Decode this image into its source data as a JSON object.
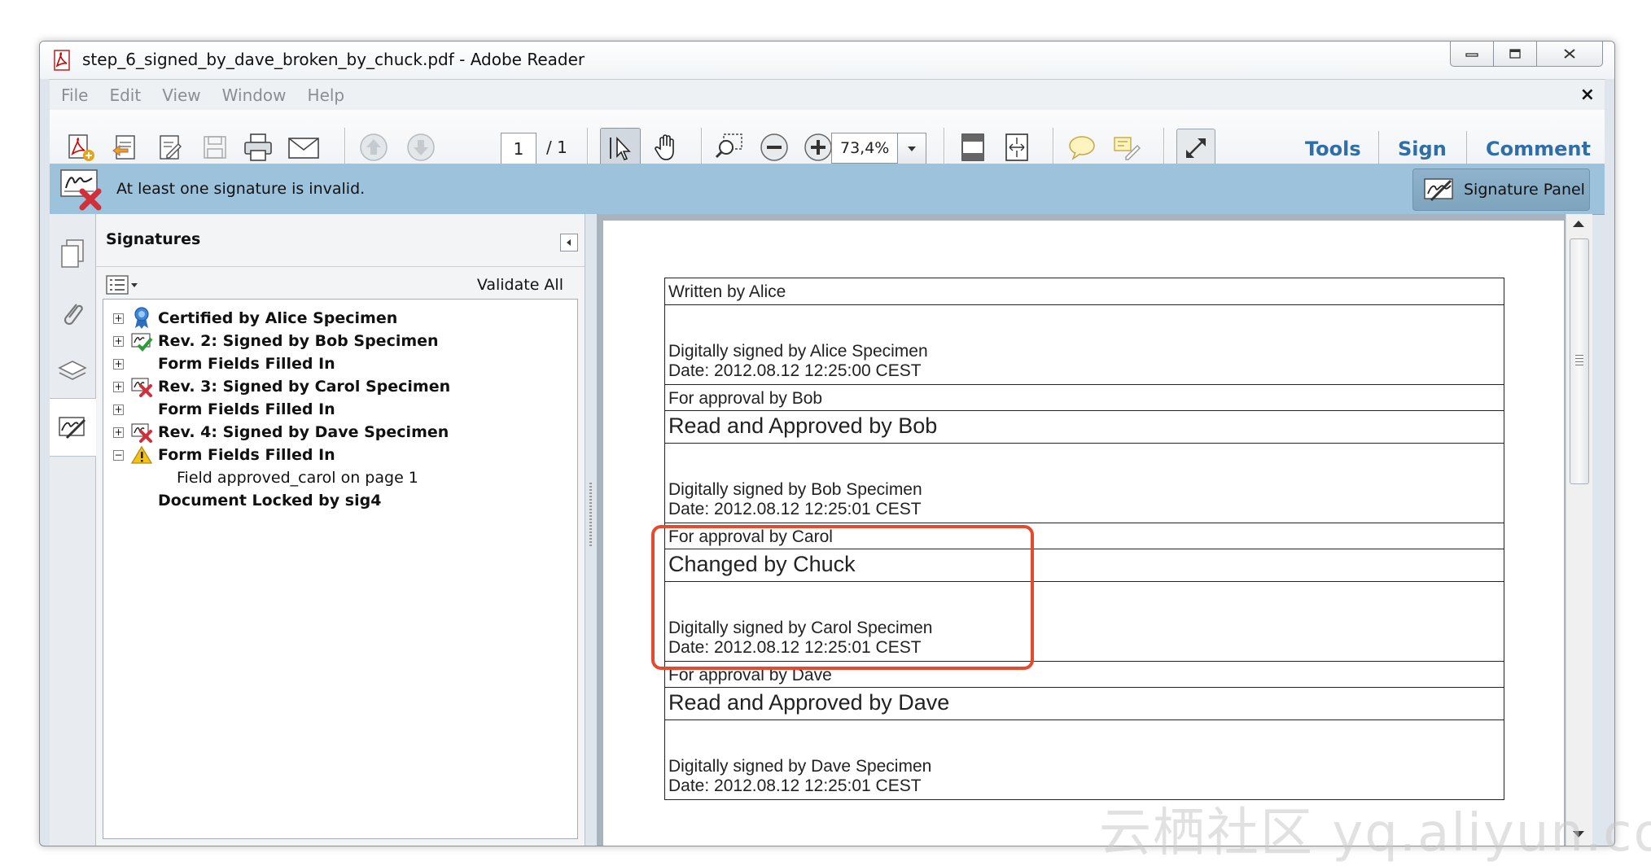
{
  "window": {
    "title": "step_6_signed_by_dave_broken_by_chuck.pdf - Adobe Reader"
  },
  "menu": {
    "items": [
      "File",
      "Edit",
      "View",
      "Window",
      "Help"
    ],
    "close_glyph": "×"
  },
  "toolbar": {
    "page_current": "1",
    "page_total": "/ 1",
    "zoom": "73,4%",
    "links": {
      "tools": "Tools",
      "sign": "Sign",
      "comment": "Comment"
    }
  },
  "infobar": {
    "message": "At least one signature is invalid.",
    "panel_button": "Signature Panel",
    "colors": {
      "background": "#9dc3dc",
      "invalid": "#d0303a"
    }
  },
  "signatures_panel": {
    "title": "Signatures",
    "validate_all": "Validate All",
    "tree": [
      {
        "label": "Certified by Alice Specimen",
        "bold": true,
        "expander": "+",
        "icon": "ribbon-icon"
      },
      {
        "label": "Rev. 2: Signed by Bob Specimen",
        "bold": true,
        "expander": "+",
        "icon": "valid-signature-icon"
      },
      {
        "label": "Form Fields Filled In",
        "bold": true,
        "expander": "+",
        "icon": ""
      },
      {
        "label": "Rev. 3: Signed by Carol Specimen",
        "bold": true,
        "expander": "+",
        "icon": "invalid-signature-icon"
      },
      {
        "label": "Form Fields Filled In",
        "bold": true,
        "expander": "+",
        "icon": ""
      },
      {
        "label": "Rev. 4: Signed by Dave Specimen",
        "bold": true,
        "expander": "+",
        "icon": "invalid-signature-icon"
      },
      {
        "label": "Form Fields Filled In",
        "bold": true,
        "expander": "−",
        "icon": "warning-icon"
      },
      {
        "label": "Field approved_carol on page 1",
        "bold": false,
        "expander": "",
        "icon": ""
      },
      {
        "label": "Document Locked by sig4",
        "bold": true,
        "expander": "",
        "icon": ""
      }
    ]
  },
  "document": {
    "rows": [
      {
        "type": "small",
        "text": "Written by Alice"
      },
      {
        "type": "sig",
        "line1": "Digitally signed by Alice Specimen",
        "line2": "Date: 2012.08.12 12:25:00 CEST"
      },
      {
        "type": "small",
        "text": "For approval by Bob"
      },
      {
        "type": "big",
        "text": "Read and Approved by Bob"
      },
      {
        "type": "sig",
        "line1": "Digitally signed by Bob Specimen",
        "line2": "Date: 2012.08.12 12:25:01 CEST"
      },
      {
        "type": "small",
        "text": "For approval by Carol"
      },
      {
        "type": "big",
        "text": "Changed by Chuck"
      },
      {
        "type": "sig",
        "line1": "Digitally signed by Carol Specimen",
        "line2": "Date: 2012.08.12 12:25:01 CEST"
      },
      {
        "type": "small",
        "text": "For approval by Dave"
      },
      {
        "type": "big",
        "text": "Read and Approved by Dave"
      },
      {
        "type": "sig",
        "line1": "Digitally signed by Dave Specimen",
        "line2": "Date: 2012.08.12 12:25:01 CEST"
      }
    ],
    "highlight_color": "#e64a2e"
  },
  "watermark": "云栖社区 yq.aliyun.com"
}
